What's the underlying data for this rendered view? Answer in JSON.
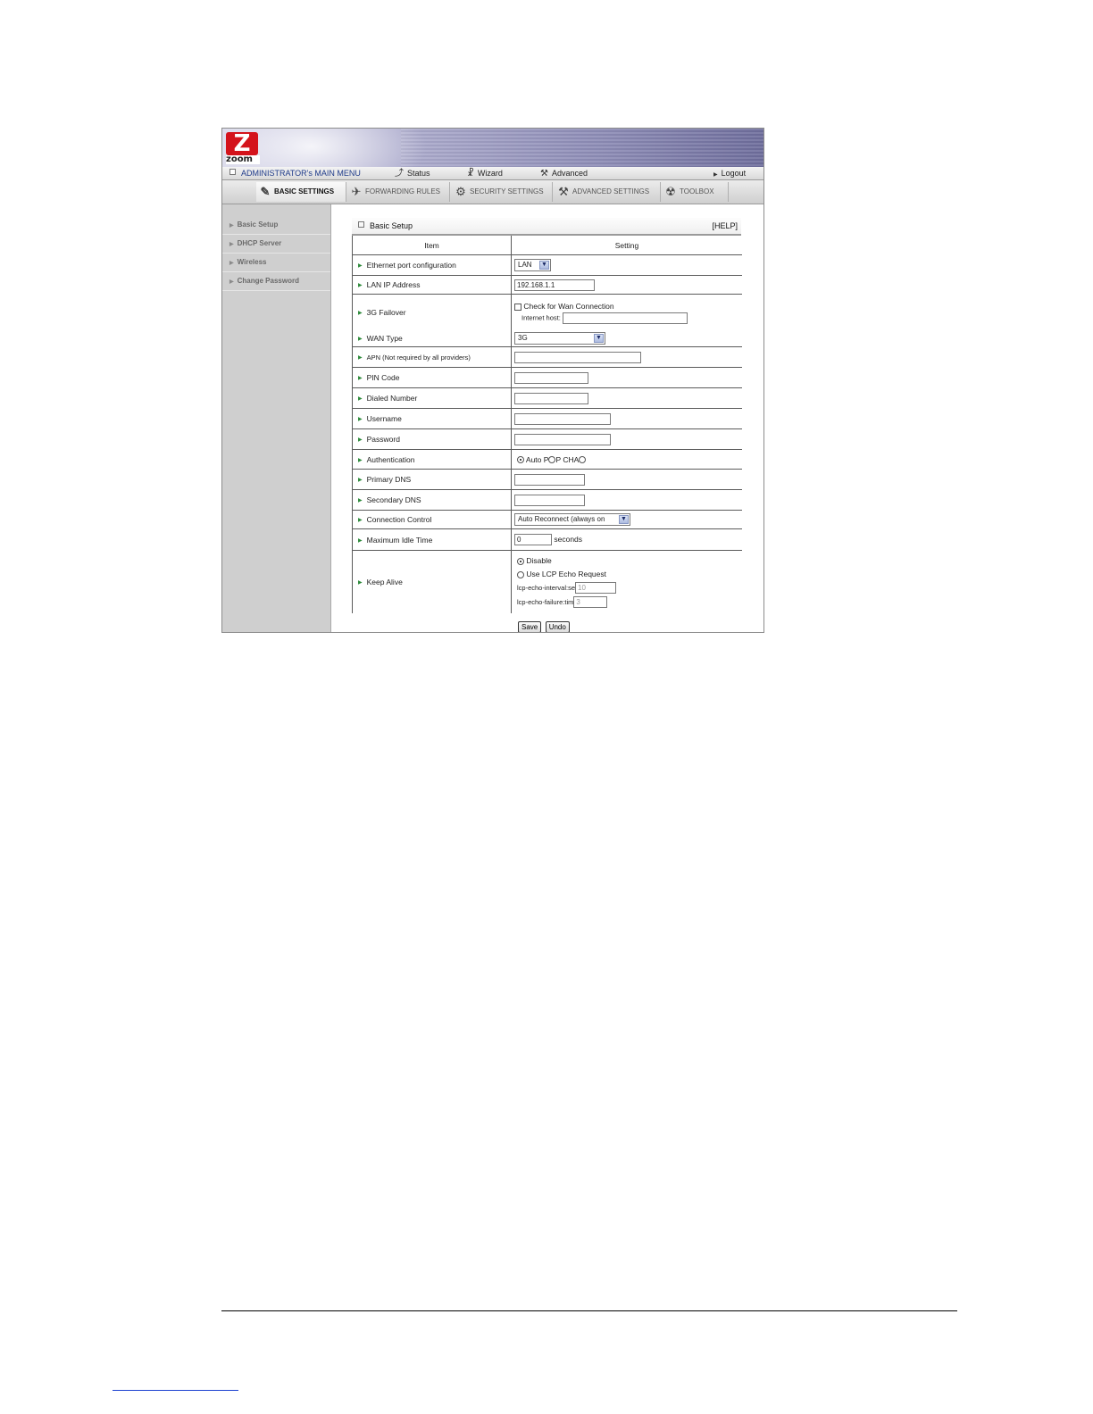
{
  "logo": {
    "letter": "Z",
    "text": "zoom"
  },
  "main_menu": {
    "title": "ADMINISTRATOR's MAIN MENU",
    "status": "Status",
    "wizard": "Wizard",
    "advanced": "Advanced",
    "logout": "Logout"
  },
  "tabs": [
    {
      "label": "BASIC SETTINGS",
      "icon": "basic-settings-icon"
    },
    {
      "label": "FORWARDING RULES",
      "icon": "forwarding-rules-icon"
    },
    {
      "label": "SECURITY SETTINGS",
      "icon": "security-settings-icon"
    },
    {
      "label": "ADVANCED SETTINGS",
      "icon": "advanced-settings-icon"
    },
    {
      "label": "TOOLBOX",
      "icon": "toolbox-icon"
    }
  ],
  "sidebar": {
    "items": [
      "Basic Setup",
      "DHCP Server",
      "Wireless",
      "Change Password"
    ]
  },
  "box": {
    "title": "Basic Setup",
    "help": "[HELP]"
  },
  "table": {
    "headers": {
      "item": "Item",
      "setting": "Setting"
    },
    "rows": {
      "ethernet": {
        "label": "Ethernet port configuration",
        "value": "LAN"
      },
      "lan_ip": {
        "label": "LAN IP Address",
        "value": "192.168.1.1"
      },
      "failover": {
        "label": "3G Failover",
        "check_label": "Check for Wan Connection",
        "host_label": "Internet host:",
        "host_value": ""
      },
      "wan_type": {
        "label": "WAN Type",
        "value": "3G"
      },
      "apn": {
        "label": "APN (Not required by all providers)",
        "value": ""
      },
      "pin": {
        "label": "PIN Code",
        "value": ""
      },
      "dialed": {
        "label": "Dialed Number",
        "value": ""
      },
      "username": {
        "label": "Username",
        "value": ""
      },
      "password": {
        "label": "Password",
        "value": ""
      },
      "auth": {
        "label": "Authentication",
        "options_text": "Auto P",
        "opt2": "P CHA"
      },
      "dns1": {
        "label": "Primary DNS",
        "value": ""
      },
      "dns2": {
        "label": "Secondary DNS",
        "value": ""
      },
      "conn": {
        "label": "Connection Control",
        "value": "Auto Reconnect (always on"
      },
      "idle": {
        "label": "Maximum Idle Time",
        "value": "0",
        "unit": "seconds"
      },
      "keepalive": {
        "label": "Keep Alive",
        "opt_disable": "Disable",
        "opt_lcp": "Use LCP Echo Request",
        "interval_label": "lcp-echo-interval:se",
        "interval_value": "10",
        "failure_label": "lcp-echo-failure:tim",
        "failure_value": "3"
      }
    }
  },
  "buttons": {
    "save": "Save",
    "undo": "Undo"
  },
  "colors": {
    "accent_link": "#1f3b8a",
    "logo_red": "#d4131b",
    "sidebar_bg": "#cfcfcf",
    "row_arrow": "#2d8a3a"
  }
}
